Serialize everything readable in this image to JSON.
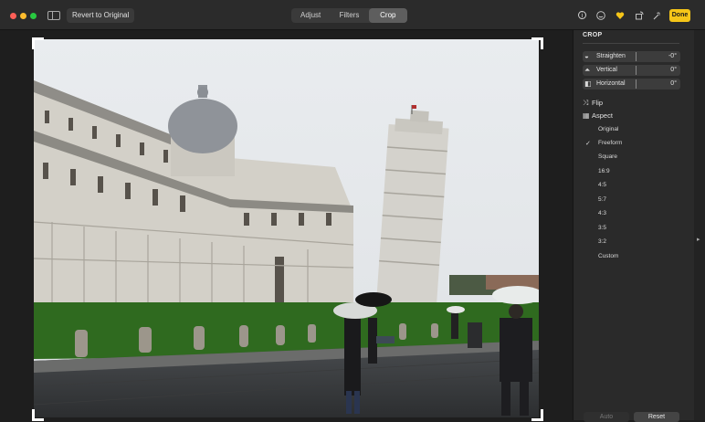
{
  "toolbar": {
    "revert_label": "Revert to Original",
    "tabs": [
      "Adjust",
      "Filters",
      "Crop"
    ],
    "active_tab": "Crop",
    "done_label": "Done",
    "icons": [
      "info-icon",
      "smiley-icon",
      "heart-icon",
      "rotate-icon",
      "magic-wand-icon"
    ],
    "accent": "#f5c518"
  },
  "panel": {
    "title": "CROP",
    "sliders": [
      {
        "label": "Straighten",
        "value": "-0°",
        "icon": "straighten-icon"
      },
      {
        "label": "Vertical",
        "value": "0°",
        "icon": "vertical-perspective-icon"
      },
      {
        "label": "Horizontal",
        "value": "0°",
        "icon": "horizontal-perspective-icon"
      }
    ],
    "flip_label": "Flip",
    "aspect_label": "Aspect",
    "aspect_options": [
      "Original",
      "Freeform",
      "Square",
      "16:9",
      "4:5",
      "5:7",
      "4:3",
      "3:5",
      "3:2",
      "Custom"
    ],
    "selected_aspect": "Freeform",
    "auto_label": "Auto",
    "reset_label": "Reset"
  }
}
